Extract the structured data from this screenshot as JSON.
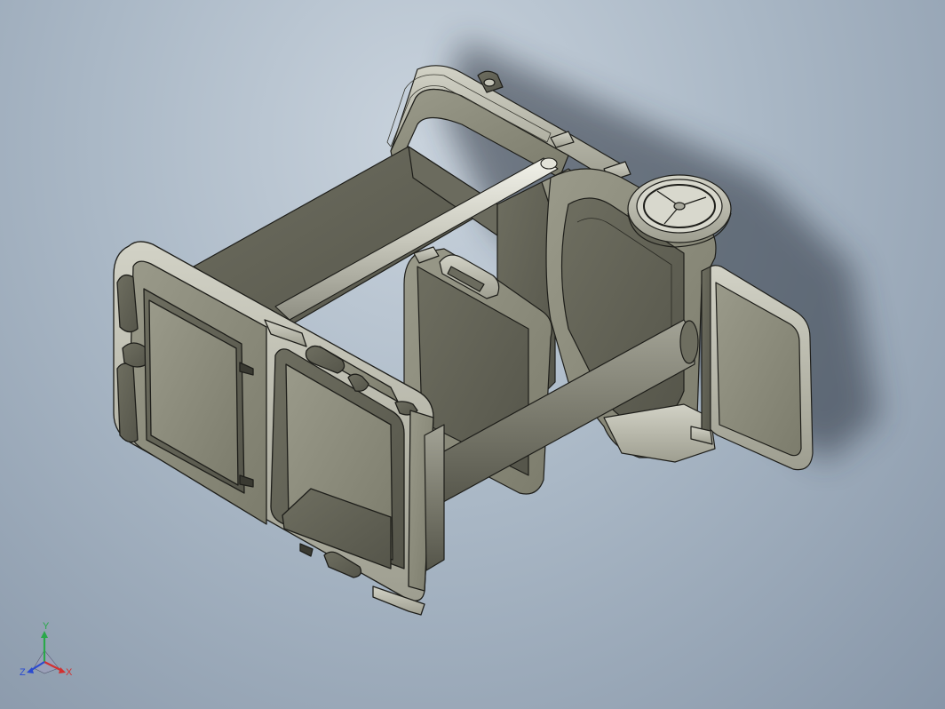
{
  "viewport": {
    "background_top": "#c9d3dd",
    "background_bottom": "#8796a8",
    "model_face_color": "#8a8a7a",
    "model_dark_color": "#5d5d50",
    "model_light_color": "#b9b9ad",
    "edge_color": "#1e1e1a",
    "shadow_color": "#2a323c"
  },
  "triad": {
    "x_label": "X",
    "y_label": "Y",
    "z_label": "Z",
    "x_color": "#d23030",
    "y_color": "#2aa84a",
    "z_color": "#2a4ad0"
  },
  "icons": {
    "triad": "coordinate-triad-icon"
  }
}
